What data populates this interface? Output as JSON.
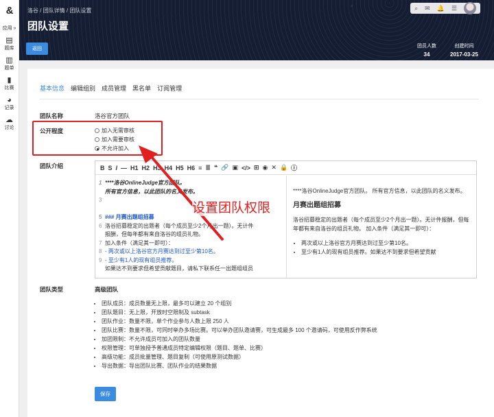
{
  "sidebar": {
    "logo": "&",
    "app_toggle": "应用 »",
    "items": [
      {
        "icon": "list-icon",
        "glyph": "▤",
        "label": "题库"
      },
      {
        "icon": "doc-icon",
        "glyph": "▥",
        "label": "题单"
      },
      {
        "icon": "bar-icon",
        "glyph": "▮",
        "label": "比赛"
      },
      {
        "icon": "pie-icon",
        "glyph": "◕",
        "label": "记录"
      },
      {
        "icon": "chat-icon",
        "glyph": "☁",
        "label": "讨论"
      }
    ]
  },
  "header": {
    "breadcrumb": "洛谷 / 团队详情 / 团队设置",
    "title": "团队设置",
    "back_label": "返回",
    "members_label": "团员人数",
    "members_value": "34",
    "created_label": "创建时间",
    "created_value": "2017-03-25"
  },
  "tabs": [
    "基本信息",
    "编辑组别",
    "成员管理",
    "黑名单",
    "订阅管理"
  ],
  "form": {
    "name_label": "团队名称",
    "name_value": "洛谷官方团队",
    "visibility_label": "公开程度",
    "visibility_options": [
      "加入无需审核",
      "加入需要审核",
      "不允许加入"
    ],
    "visibility_selected": "不允许加入",
    "intro_label": "团队介绍",
    "type_label": "团队类型",
    "type_value": "高级团队",
    "save_label": "保存"
  },
  "editor": {
    "toolbar": [
      "B",
      "S",
      "I",
      "—",
      "H1",
      "H2",
      "H3",
      "H4",
      "H5",
      "H6",
      "≡",
      "≣",
      "❝",
      "🔗",
      "▣",
      "</>",
      "⊞",
      "◉",
      "✕",
      "🔒",
      "ⓘ"
    ],
    "source_lines": [
      {
        "n": "1",
        "text": "****洛谷OnlineJudge官方团队。"
      },
      {
        "n": "",
        "text": "所有官方信息，以此团队的名义发布。"
      },
      {
        "n": "3",
        "text": ""
      },
      {
        "n": "",
        "text": ""
      },
      {
        "n": "5",
        "text": "### 月赛出题组招募"
      },
      {
        "n": "6",
        "text": "洛谷招募稳定的出题者（每个成员至少2个月出一题）。无计件"
      },
      {
        "n": "",
        "text": "报酬，但每年都有来自洛谷的组员礼物。"
      },
      {
        "n": "7",
        "text": "加入条件（满足其一即可）："
      },
      {
        "n": "8",
        "text": "- 两次或以上洛谷官方月赛达到过至少第10名。"
      },
      {
        "n": "9",
        "text": "- 至少有1人的现有组员推荐。"
      },
      {
        "n": "",
        "text": "如果达不到要求但希望贡献题目，请私下联系任一出题组组员"
      }
    ],
    "preview_intro": "****洛谷OnlineJudge官方团队。 所有官方信息，以此团队的名义发布。",
    "preview_heading": "月赛出题组招募",
    "preview_para": "洛谷招募稳定的出题者（每个成员至少2个月出一题）。无计件报酬，但每年都有来自洛谷的组员礼物。 加入条件（满足其一即可）：",
    "preview_bullets": [
      "两次或以上洛谷官方月赛达到过至少第10名。",
      "至少有1人的现有组员推荐。如果达不到要求但希望贡献"
    ]
  },
  "callout": "设置团队权限",
  "team_features": [
    "团队成员：成员数量无上限，最多可以建立 20 个组别",
    "团队题目：无上限，开放时空限制及 subtask",
    "团队作业：数量不限，单个作业参与人数上限 250 人",
    "团队比赛：数量不限，可同时举办多场比赛。可以举办团队邀请赛，可生成最多 100 个邀请码，可使用反作弊系统",
    "加团限制：不允许成员可加入的团队数量",
    "权限管理：可单独授予普通成员特定编辑权限（题目、题单、比赛）",
    "高级功能：成员批量管理、题目复制（可使用原测试数据）",
    "导出数据：导出团队比赛、团队作业的结果数据"
  ],
  "colors": {
    "accent": "#3b8be0",
    "annotation": "#e02020"
  }
}
